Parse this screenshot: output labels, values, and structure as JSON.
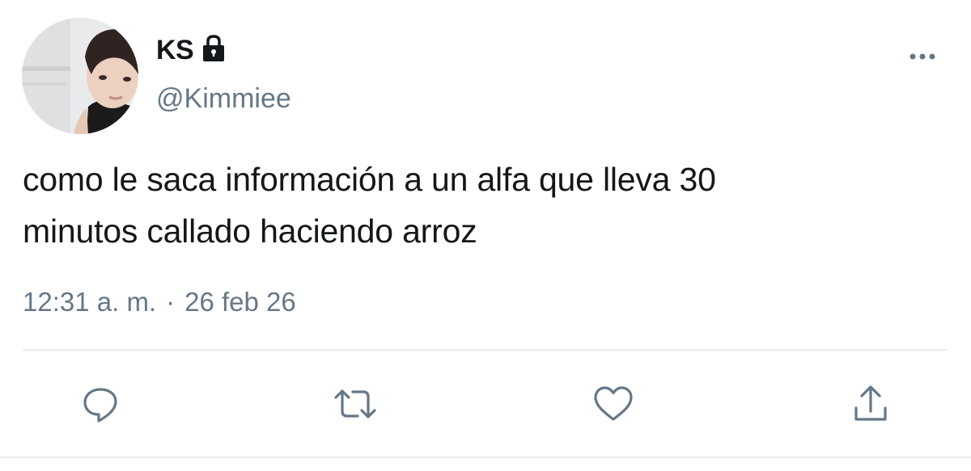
{
  "user": {
    "display_name": "KS",
    "handle": "@Kimmiee",
    "protected_icon": "lock-icon",
    "avatar": "profile-photo"
  },
  "tweet": {
    "text_line1": "como le saca información a un alfa que lleva 30",
    "text_line2": "minutos callado haciendo arroz",
    "time": "12:31 a. m.",
    "separator": "·",
    "date": "26 feb 26"
  },
  "actions": {
    "reply_icon": "reply-icon",
    "retweet_icon": "retweet-icon",
    "like_icon": "heart-icon",
    "share_icon": "share-icon",
    "more_icon": "more-options-icon"
  },
  "colors": {
    "text_primary": "#14171a",
    "text_secondary": "#657786",
    "divider": "#e6ecf0"
  }
}
